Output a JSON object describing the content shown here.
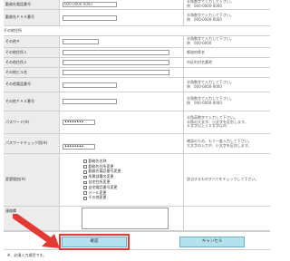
{
  "rows": [
    {
      "label": "勤務先電話番号",
      "value": "000-0000-0000",
      "notes": [
        "半角数字で入力して下さい。",
        "例　000-0000-0000"
      ]
    },
    {
      "label": "勤務先ＦＡＸ番号",
      "value": "",
      "notes": [
        "半角数字で入力して下さい。",
        "例　000-0000-0000"
      ]
    }
  ],
  "section_title": "その他住所",
  "other_rows": [
    {
      "label": "その他〒",
      "value": "",
      "notes": [
        "半角数字で入力して下さい。",
        "例　000-0000"
      ]
    },
    {
      "label": "その他住所１",
      "value": "",
      "notes": [
        "都道府県名"
      ]
    },
    {
      "label": "その他住所２",
      "value": "",
      "notes": [
        "市区町村名番地"
      ]
    },
    {
      "label": "その他ビル名",
      "value": "",
      "notes": []
    },
    {
      "label": "その他電話番号",
      "value": "",
      "notes": [
        "半角数字で入力して下さい。",
        "例　000-0000-0000"
      ]
    },
    {
      "label": "その他ＦＡＸ番号",
      "value": "",
      "notes": [
        "半角数字で入力して下さい。",
        "例　000-0000-0000"
      ]
    }
  ],
  "password": {
    "label": "パスワード(※)",
    "value": "••••••••",
    "notes": [
      "半角英数字で入力して下さい。",
      "半角の大文字、小文字を区別します。",
      "６文字以上１０文字以内"
    ]
  },
  "password_check": {
    "label": "パスワードチェック用(※)",
    "value": "••••••••",
    "notes": [
      "確認のため、もう一度入力して下さい。",
      "大文字の入力や、小文字を区別します。"
    ]
  },
  "change_type": {
    "label": "変更理由(※)",
    "options": [
      "勤務先名称",
      "勤務先住所変更",
      "勤務先電話番号変更",
      "所属部署名変更",
      "自宅住所変更",
      "自宅電話番号変更",
      "メール変更",
      "その他変更"
    ],
    "note": "該当するものすべてをチェックして下さい。"
  },
  "remarks": {
    "label": "連絡欄"
  },
  "buttons": {
    "confirm": "確認",
    "cancel": "キャンセル"
  },
  "footnote": "※、必須入力項目です。"
}
